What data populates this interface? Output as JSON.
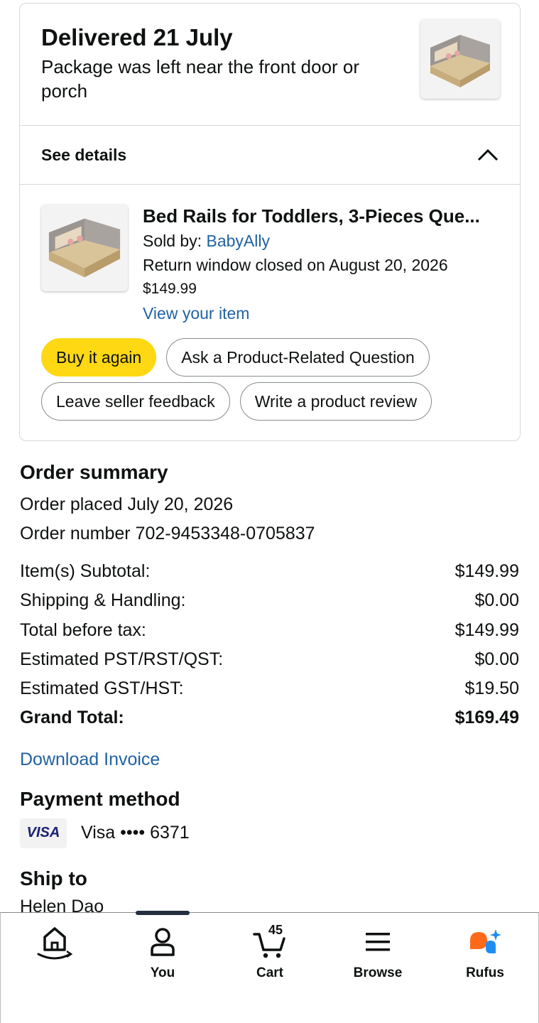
{
  "delivery": {
    "title": "Delivered 21 July",
    "subtitle": "Package was left near the front door or porch"
  },
  "details": {
    "label": "See details"
  },
  "item": {
    "title": "Bed Rails for Toddlers, 3-Pieces Que...",
    "sold_by_label": "Sold by: ",
    "seller": "BabyAlly",
    "return_window": "Return window closed on August 20, 2026",
    "price": "$149.99",
    "view_link": "View your item"
  },
  "buttons": {
    "buy_again": "Buy it again",
    "ask_question": "Ask a Product-Related Question",
    "seller_feedback": "Leave seller feedback",
    "write_review": "Write a product review"
  },
  "summary": {
    "title": "Order summary",
    "placed": "Order placed July 20, 2026",
    "number": "Order number 702-9453348-0705837",
    "rows": [
      {
        "label": "Item(s) Subtotal:",
        "value": "$149.99"
      },
      {
        "label": "Shipping & Handling:",
        "value": "$0.00"
      },
      {
        "label": "Total before tax:",
        "value": "$149.99"
      },
      {
        "label": "Estimated PST/RST/QST:",
        "value": "$0.00"
      },
      {
        "label": "Estimated GST/HST:",
        "value": "$19.50"
      }
    ],
    "grand_total_label": "Grand Total:",
    "grand_total_value": "$169.49",
    "invoice_link": "Download Invoice"
  },
  "payment": {
    "title": "Payment method",
    "card_brand": "VISA",
    "card_text": "Visa •••• 6371"
  },
  "ship": {
    "title": "Ship to",
    "name": "Helen Dao"
  },
  "nav": {
    "items": [
      {
        "label": "",
        "icon": "home-icon"
      },
      {
        "label": "You",
        "icon": "person-icon"
      },
      {
        "label": "Cart",
        "icon": "cart-icon",
        "count": "45"
      },
      {
        "label": "Browse",
        "icon": "menu-icon"
      },
      {
        "label": "Rufus",
        "icon": "rufus-icon"
      }
    ]
  },
  "colors": {
    "link": "#2162a1",
    "primary_button": "#ffd814",
    "rufus_orange": "#ff6a1a",
    "rufus_blue": "#1f8cf0"
  }
}
